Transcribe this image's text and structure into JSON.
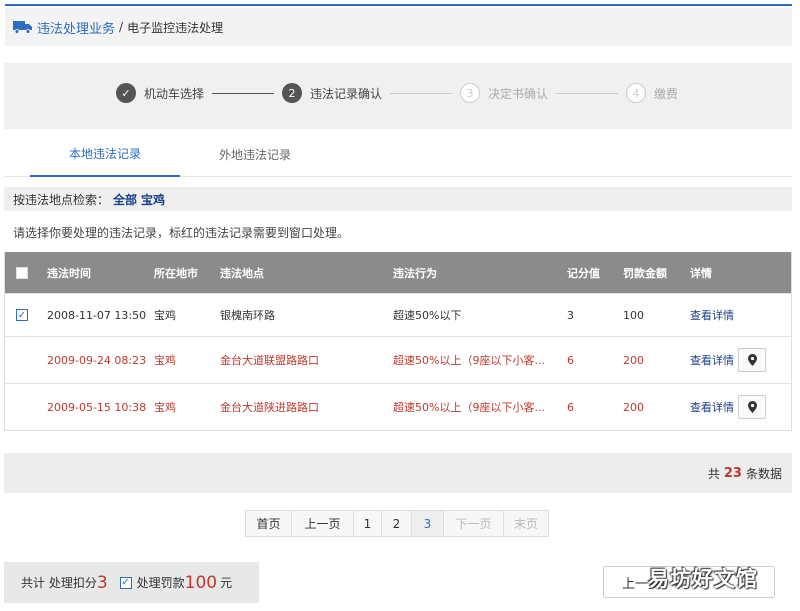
{
  "breadcrumb": {
    "main": "违法处理业务",
    "separator": "/",
    "sub": "电子监控违法处理"
  },
  "steps": [
    {
      "num": "✓",
      "label": "机动车选择"
    },
    {
      "num": "2",
      "label": "违法记录确认"
    },
    {
      "num": "3",
      "label": "决定书确认"
    },
    {
      "num": "4",
      "label": "缴费"
    }
  ],
  "tabs": {
    "local": "本地违法记录",
    "remote": "外地违法记录"
  },
  "filter": {
    "label": "按违法地点检索：",
    "all": "全部",
    "city": "宝鸡"
  },
  "hint": "请选择你要处理的违法记录，标红的违法记录需要到窗口处理。",
  "table": {
    "headers": [
      "违法时间",
      "所在地市",
      "违法地点",
      "违法行为",
      "记分值",
      "罚款金额",
      "详情"
    ],
    "rows": [
      {
        "time": "2008-11-07 13:50",
        "city": "宝鸡",
        "place": "银槐南环路",
        "behavior": "超速50%以下",
        "points": "3",
        "fine": "100",
        "detail": "查看详情"
      },
      {
        "time": "2009-09-24 08:23",
        "city": "宝鸡",
        "place": "金台大道联盟路路口",
        "behavior": "超速50%以上（9座以下小客...",
        "points": "6",
        "fine": "200",
        "detail": "查看详情"
      },
      {
        "time": "2009-05-15 10:38",
        "city": "宝鸡",
        "place": "金台大道陕进路路口",
        "behavior": "超速50%以上（9座以下小客...",
        "points": "6",
        "fine": "200",
        "detail": "查看详情"
      }
    ]
  },
  "total": {
    "prefix": "共",
    "count": "23",
    "suffix": "条数据"
  },
  "pager": {
    "first": "首页",
    "prev": "上一页",
    "p1": "1",
    "p2": "2",
    "p3": "3",
    "next": "下一页",
    "last": "末页"
  },
  "footer": {
    "prefix": "共计 处理扣分",
    "points": "3",
    "fine_label": "处理罚款",
    "fine": "100",
    "unit": "元"
  },
  "prev_button": "上一步",
  "watermark": "易坊好文馆",
  "colors": {
    "accent": "#2c6dc1",
    "warning": "#c0392b",
    "header_bg": "#8b8b8b"
  },
  "icons": {
    "truck": "truck-icon",
    "pin": "location-pin-icon",
    "check": "checkmark-icon"
  }
}
